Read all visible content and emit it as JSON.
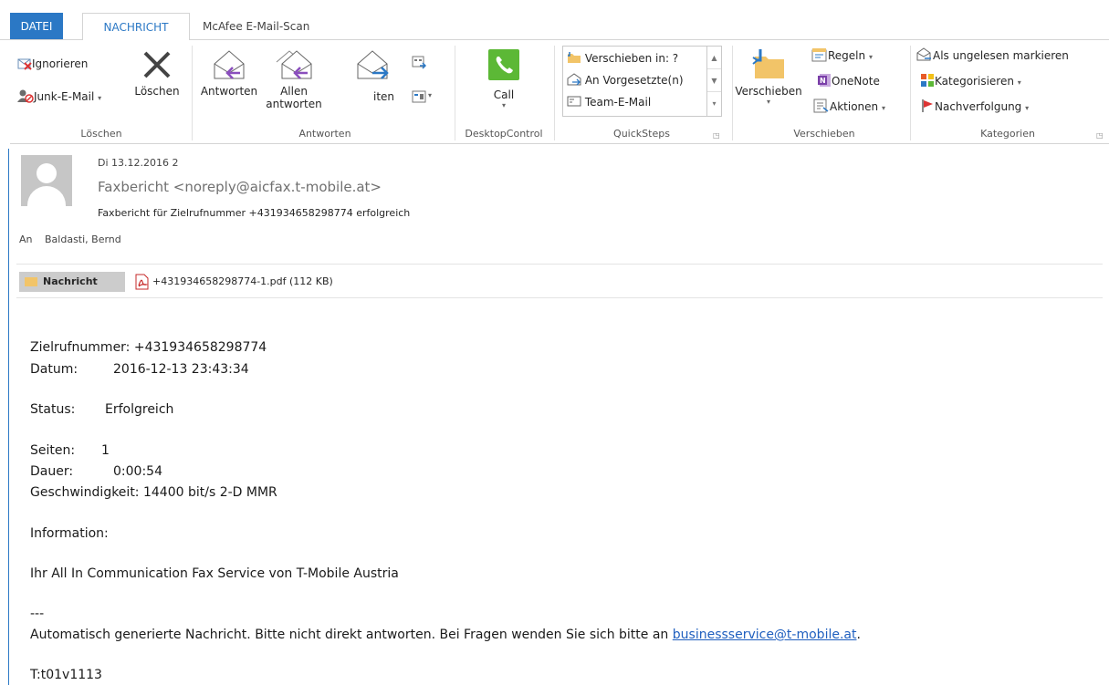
{
  "tabs": {
    "file": "DATEI",
    "message": "NACHRICHT",
    "mcafee": "McAfee E-Mail-Scan"
  },
  "ribbon": {
    "delete_group": {
      "label": "Löschen",
      "ignore": "Ignorieren",
      "junk": "Junk-E-Mail",
      "delete": "Löschen"
    },
    "respond_group": {
      "label": "Antworten",
      "reply": "Antworten",
      "reply_all_1": "Allen",
      "reply_all_2": "antworten",
      "forward_partial": "iten"
    },
    "desktop_group": {
      "label": "DesktopControl",
      "call": "Call"
    },
    "quicksteps_group": {
      "label": "QuickSteps",
      "items": [
        "Verschieben in: ?",
        "An Vorgesetzte(n)",
        "Team-E-Mail"
      ]
    },
    "move_group": {
      "label": "Verschieben",
      "move": "Verschieben",
      "rules": "Regeln",
      "onenote": "OneNote",
      "actions": "Aktionen"
    },
    "tags_group": {
      "label": "Kategorien",
      "mark_unread": "Als ungelesen markieren",
      "categorize": "Kategorisieren",
      "followup": "Nachverfolgung"
    }
  },
  "message": {
    "date": "Di 13.12.2016 2",
    "from": "Faxbericht <noreply@aicfax.t-mobile.at>",
    "subject": "Faxbericht für Zielrufnummer +431934658298774 erfolgreich",
    "to_label": "An",
    "to_value": "Baldasti, Bernd",
    "attachments": {
      "message_tab": "Nachricht",
      "file": "+431934658298774-1.pdf (112 KB)"
    }
  },
  "body": {
    "target_label": "Zielrufnummer:",
    "target_value": "+431934658298774",
    "date_label": "Datum:",
    "date_value": "2016-12-13 23:43:34",
    "status_label": "Status:",
    "status_value": "Erfolgreich",
    "pages_label": "Seiten:",
    "pages_value": "1",
    "duration_label": "Dauer:",
    "duration_value": "0:00:54",
    "speed_label": "Geschwindigkeit:",
    "speed_value": "14400 bit/s 2-D MMR",
    "information": "Information:",
    "signature": "Ihr All In Communication Fax Service von T-Mobile Austria",
    "separator": "---",
    "auto_text": "Automatisch generierte Nachricht. Bitte nicht direkt antworten. Bei Fragen wenden Sie sich bitte an",
    "email_link": "businessservice@t-mobile.at",
    "auto_end": ".",
    "code": "T:t01v1113"
  },
  "colors": {
    "accent": "#2b78c5",
    "call_green": "#5cb836",
    "link": "#1f5fbf"
  }
}
